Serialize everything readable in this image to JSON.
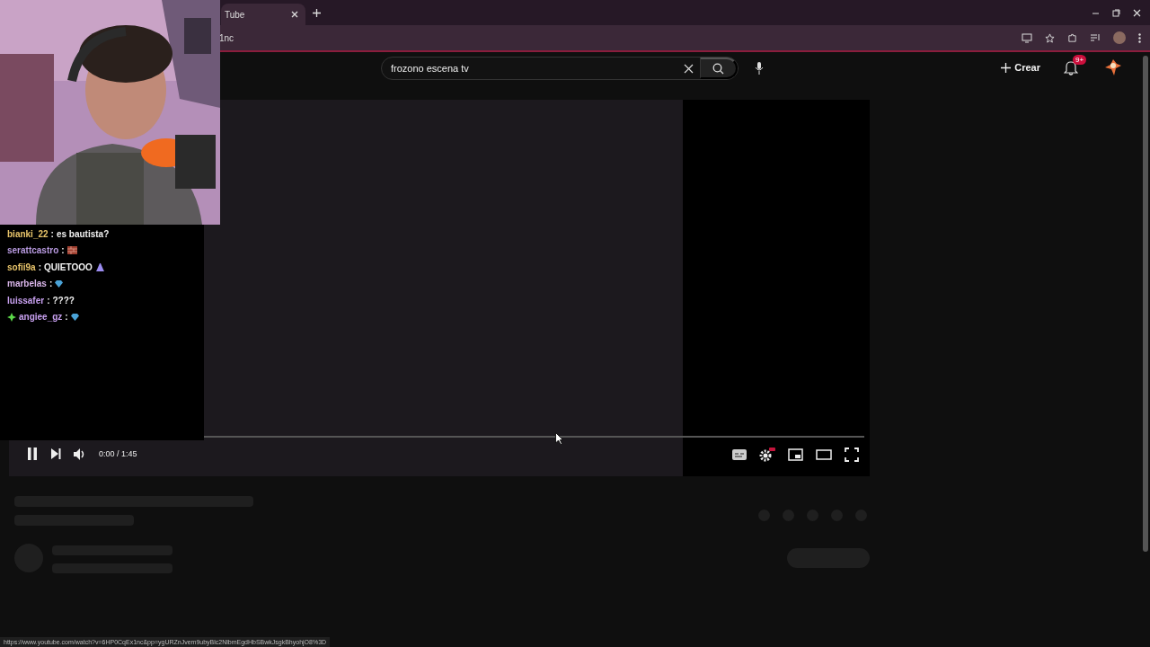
{
  "browser": {
    "tab": {
      "title": "Tube"
    },
    "address": "1nc"
  },
  "masthead": {
    "search": {
      "value": "frozono escena tv"
    },
    "create_label": "Crear",
    "notification_badge": "9+"
  },
  "chat": [
    {
      "user": "bianki_22",
      "color": "#e8c46a",
      "separator": ":",
      "message": "es bautista?",
      "badge": false
    },
    {
      "user": "serattcastro",
      "color": "#b89ae0",
      "separator": ":",
      "emote": {
        "kind": "brick"
      },
      "badge": false
    },
    {
      "user": "sofii9a",
      "color": "#e8c46a",
      "separator": ":",
      "message": "QUIETOOO",
      "emote": {
        "kind": "hands"
      },
      "badge": false
    },
    {
      "user": "marbelas",
      "color": "#d8b4e8",
      "separator": ":",
      "emote": {
        "kind": "gem"
      },
      "badge": false
    },
    {
      "user": "luissafer",
      "color": "#c8a0f0",
      "separator": ":",
      "message": "????",
      "badge": false
    },
    {
      "user": "angiee_gz",
      "color": "#c8a0f0",
      "separator": ":",
      "emote": {
        "kind": "gem"
      },
      "badge": true
    }
  ],
  "player": {
    "playing": true,
    "progress": {
      "level": 0.007
    },
    "time": "0:00 / 1:45"
  },
  "status_url": "https://www.youtube.com/watch?v=6HP0CqEx1nc&pp=ygURZnJvem9ubyBlc2NlbmEgdHbSBwkJsgkBhyohjO8%3D"
}
